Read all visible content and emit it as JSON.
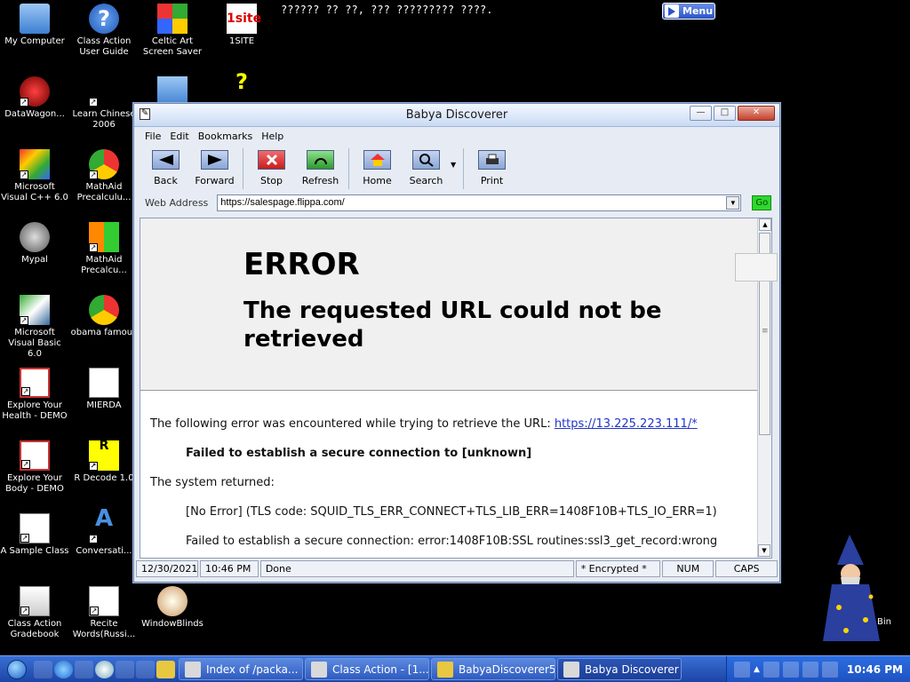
{
  "desktop": {
    "icons": [
      {
        "label": "My Computer"
      },
      {
        "label": "Class Action User Guide"
      },
      {
        "label": "Celtic Art Screen Saver"
      },
      {
        "label": "1SITE"
      },
      {
        "label": "DataWagon..."
      },
      {
        "label": "Learn Chinese 2006"
      },
      {
        "label": "Microsoft Visual C++ 6.0"
      },
      {
        "label": "MathAid Precalculu..."
      },
      {
        "label": "Mypal"
      },
      {
        "label": "MathAid Precalcu..."
      },
      {
        "label": "Microsoft Visual Basic 6.0"
      },
      {
        "label": "obama famous"
      },
      {
        "label": "Explore Your Health - DEMO"
      },
      {
        "label": "MIERDA"
      },
      {
        "label": "Explore Your Body - DEMO"
      },
      {
        "label": "R Decode 1.0"
      },
      {
        "label": "A Sample Class"
      },
      {
        "label": "Conversati..."
      },
      {
        "label": "Class Action Gradebook"
      },
      {
        "label": "Recite Words(Russi..."
      },
      {
        "label": "WindowBlinds"
      }
    ],
    "ticker": "?????? ?? ??, ??? ????????? ????.",
    "menu_button": "Menu",
    "bin_label": "Bin"
  },
  "window": {
    "title": "Babya Discoverer",
    "menu": [
      "File",
      "Edit",
      "Bookmarks",
      "Help"
    ],
    "toolbar": [
      "Back",
      "Forward",
      "Stop",
      "Refresh",
      "Home",
      "Search",
      "Print"
    ],
    "address_label": "Web Address",
    "address_value": "https://salespage.flippa.com/",
    "go_label": "Go",
    "page": {
      "h1": "ERROR",
      "h2": "The requested URL could not be retrieved",
      "p1_text": "The following error was encountered while trying to retrieve the URL: ",
      "p1_link": "https://13.225.223.111/*",
      "p2": "Failed to establish a secure connection to [unknown]",
      "p3": "The system returned:",
      "p4": "[No Error] (TLS code: SQUID_TLS_ERR_CONNECT+TLS_LIB_ERR=1408F10B+TLS_IO_ERR=1)",
      "p5": "Failed to establish a secure connection: error:1408F10B:SSL routines:ssl3_get_record:wrong"
    },
    "status": {
      "date": "12/30/2021",
      "time": "10:46 PM",
      "text": "Done",
      "encrypted": "* Encrypted *",
      "num": "NUM",
      "caps": "CAPS"
    }
  },
  "taskbar": {
    "tasks": [
      "Index of /packa...",
      "Class Action - [1...",
      "BabyaDiscoverer5",
      "Babya Discoverer"
    ],
    "clock": "10:46 PM"
  }
}
